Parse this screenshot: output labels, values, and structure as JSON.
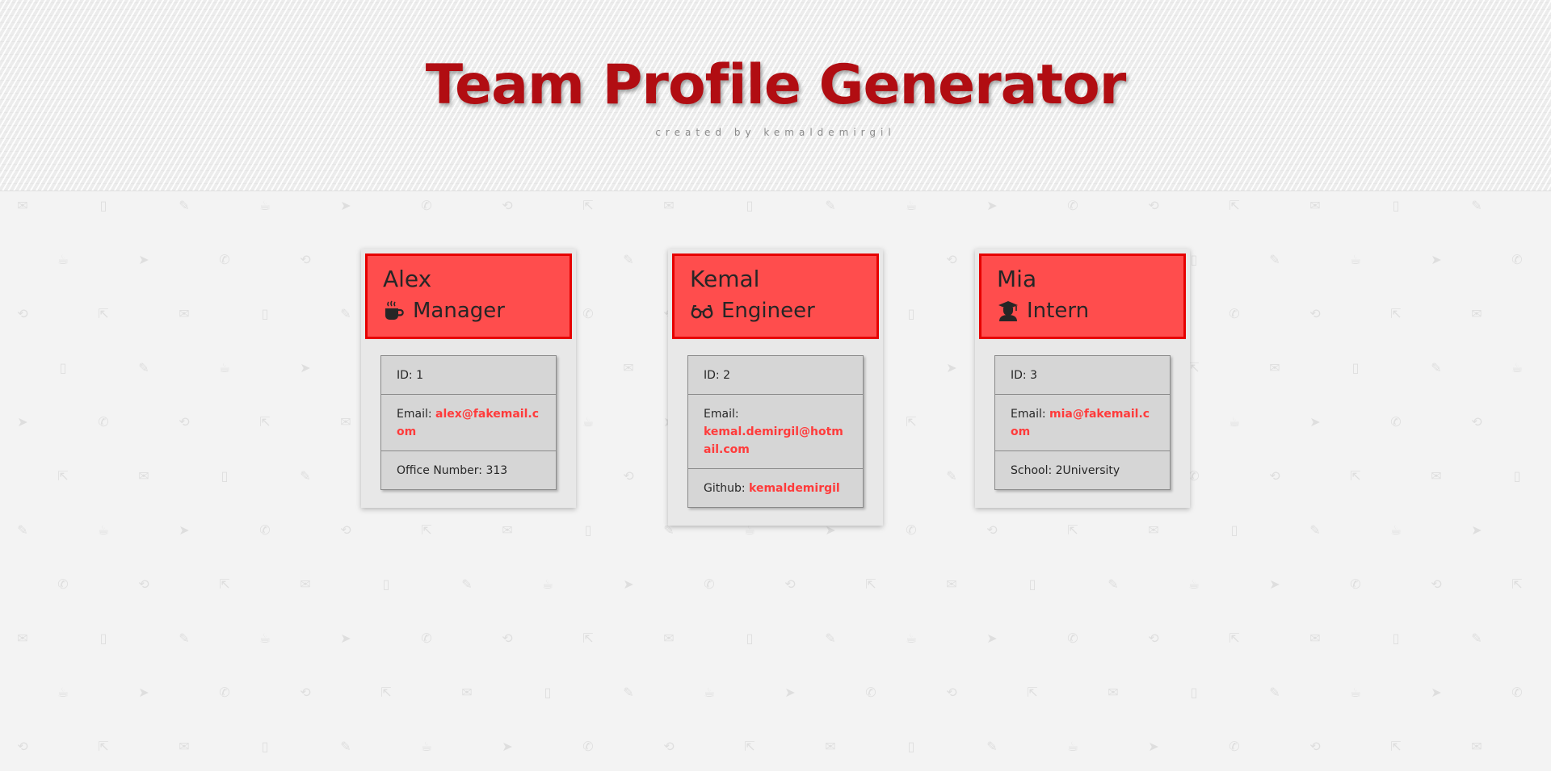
{
  "header": {
    "title": "Team Profile Generator",
    "subtitle": "created by kemaldemirgil"
  },
  "colors": {
    "title": "#b10d12",
    "card_header": "#ff4d4d",
    "card_header_border": "#e60000",
    "link": "#ff3b3b"
  },
  "employees": [
    {
      "name": "Alex",
      "role": "Manager",
      "icon": "coffee-mug-icon",
      "id_text": "ID: 1",
      "email_label": "Email: ",
      "email": "alex@fakemail.com",
      "extra_label": "Office Number: 313",
      "extra_link": ""
    },
    {
      "name": "Kemal",
      "role": "Engineer",
      "icon": "glasses-icon",
      "id_text": "ID: 2",
      "email_label": "Email: ",
      "email": "kemal.demirgil@hotmail.com",
      "extra_label": "Github: ",
      "extra_link": "kemaldemirgil"
    },
    {
      "name": "Mia",
      "role": "Intern",
      "icon": "graduate-icon",
      "id_text": "ID: 3",
      "email_label": "Email: ",
      "email": "mia@fakemail.com",
      "extra_label": "School: 2University",
      "extra_link": ""
    }
  ]
}
